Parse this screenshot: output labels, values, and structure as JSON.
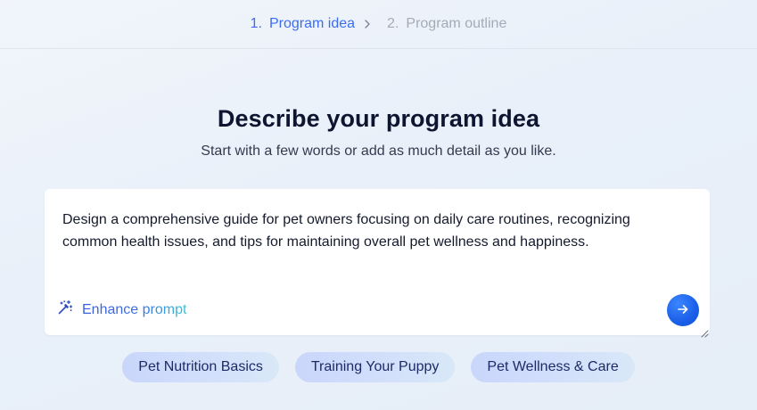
{
  "stepper": {
    "steps": [
      {
        "number": "1.",
        "label": "Program idea",
        "state": "active"
      },
      {
        "number": "2.",
        "label": "Program outline",
        "state": "inactive"
      }
    ]
  },
  "header": {
    "title": "Describe your program idea",
    "subtitle": "Start with a few words or add as much detail as you like."
  },
  "prompt": {
    "value": "Design a comprehensive guide for pet owners focusing on daily care routines, recognizing common health issues, and tips for maintaining overall pet wellness and happiness.",
    "enhance_label": "Enhance prompt",
    "enhance_icon": "magic-wand-icon",
    "send_icon": "arrow-right-icon"
  },
  "suggestions": [
    {
      "label": "Pet Nutrition Basics"
    },
    {
      "label": "Training Your Puppy"
    },
    {
      "label": "Pet Wellness & Care"
    }
  ],
  "colors": {
    "accent": "#3c6df0",
    "send_button": "#1a5fe8",
    "chip_background": "#d3e0fb"
  }
}
